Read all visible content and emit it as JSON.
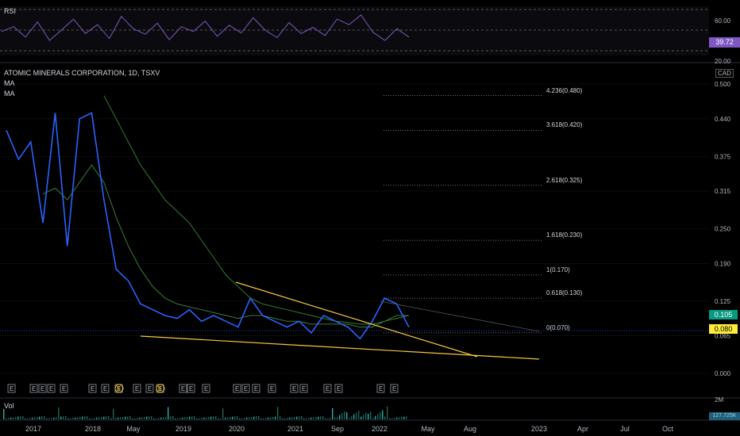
{
  "rsi": {
    "label": "RSI",
    "ticks": [
      "60.00",
      "20.00"
    ],
    "current": "39.72",
    "color": "#7e57c2"
  },
  "main": {
    "title": "ATOMIC MINERALS CORPORATION, 1D, TSXV",
    "ma1": "MA",
    "ma2": "MA",
    "currency": "CAD",
    "price_badges": {
      "ma": "0.105",
      "last": "0.080"
    }
  },
  "volume": {
    "label": "Vol",
    "tick": "2M",
    "badge": "127.725K"
  },
  "time_axis": [
    "2017",
    "2018",
    "May",
    "2019",
    "2020",
    "2021",
    "Sep",
    "2022",
    "May",
    "Aug",
    "2023",
    "Apr",
    "Jul",
    "Oct"
  ],
  "earnings_marker": "E",
  "dividend_marker": "$",
  "colors": {
    "price": "#2962ff",
    "ma": "#2e7d32",
    "trend": "#f5c542",
    "fib": "#787b86",
    "badge_green": "#089981",
    "badge_yellow": "#ffeb3b"
  },
  "chart_data": {
    "type": "line",
    "title": "ATOMIC MINERALS CORPORATION, 1D, TSXV",
    "xlabel": "",
    "ylabel": "",
    "y_ticks": [
      0.5,
      0.44,
      0.375,
      0.315,
      0.25,
      0.19,
      0.125,
      0.065,
      0.0
    ],
    "ylim": [
      -0.01,
      0.52
    ],
    "x": [
      "2016-11",
      "2017-01",
      "2017-03",
      "2017-05",
      "2017-07",
      "2017-09",
      "2017-11",
      "2018-01",
      "2018-03",
      "2018-05",
      "2018-07",
      "2018-09",
      "2018-11",
      "2019-01",
      "2019-03",
      "2019-05",
      "2019-07",
      "2019-09",
      "2019-11",
      "2020-01",
      "2020-03",
      "2020-05",
      "2020-07",
      "2020-09",
      "2020-11",
      "2021-01",
      "2021-03",
      "2021-05",
      "2021-07",
      "2021-09",
      "2021-11",
      "2022-01",
      "2022-03",
      "2022-05"
    ],
    "series": [
      {
        "values": [
          0.42,
          0.37,
          0.4,
          0.26,
          0.45,
          0.22,
          0.44,
          0.45,
          0.3,
          0.18,
          0.16,
          0.12,
          0.11,
          0.1,
          0.095,
          0.11,
          0.09,
          0.1,
          0.09,
          0.08,
          0.13,
          0.1,
          0.09,
          0.08,
          0.09,
          0.07,
          0.1,
          0.09,
          0.08,
          0.06,
          0.09,
          0.13,
          0.12,
          0.08
        ]
      },
      {
        "values": [
          null,
          null,
          null,
          0.31,
          0.32,
          0.3,
          0.33,
          0.36,
          0.33,
          0.27,
          0.22,
          0.18,
          0.15,
          0.13,
          0.12,
          0.115,
          0.11,
          0.105,
          0.1,
          0.095,
          0.1,
          0.1,
          0.095,
          0.09,
          0.09,
          0.085,
          0.085,
          0.085,
          0.085,
          0.08,
          0.08,
          0.09,
          0.1,
          0.1
        ]
      },
      {
        "values": [
          null,
          null,
          null,
          null,
          null,
          null,
          null,
          null,
          0.48,
          0.44,
          0.4,
          0.36,
          0.33,
          0.3,
          0.28,
          0.26,
          0.23,
          0.2,
          0.17,
          0.15,
          0.13,
          0.12,
          0.115,
          0.11,
          0.105,
          0.1,
          0.095,
          0.09,
          0.088,
          0.085,
          0.085,
          0.09,
          0.095,
          0.1
        ]
      }
    ],
    "fibonacci": [
      {
        "label": "4.236(0.480)",
        "value": 0.48
      },
      {
        "label": "3.618(0.420)",
        "value": 0.42
      },
      {
        "label": "2.618(0.325)",
        "value": 0.325
      },
      {
        "label": "1.618(0.230)",
        "value": 0.23
      },
      {
        "label": "1(0.170)",
        "value": 0.17
      },
      {
        "label": "0.618(0.130)",
        "value": 0.13
      },
      {
        "label": "0(0.070)",
        "value": 0.07
      }
    ],
    "rsi_ticks": [
      60,
      20
    ],
    "last_value": 0.08
  }
}
